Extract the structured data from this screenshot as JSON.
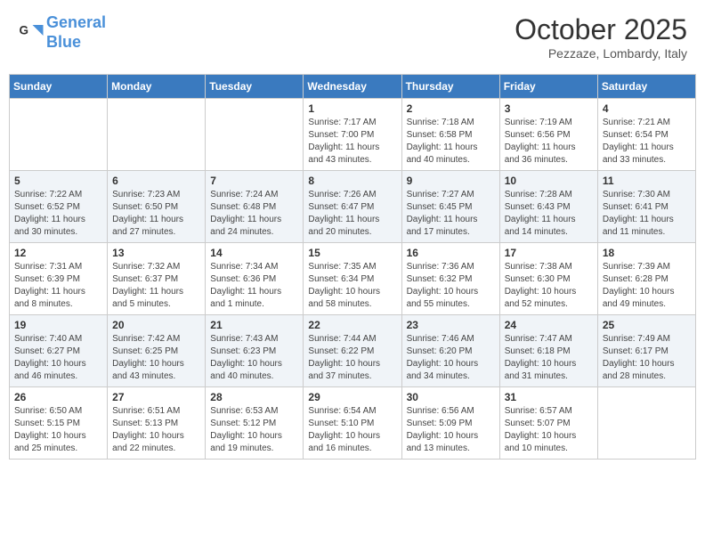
{
  "header": {
    "logo_line1": "General",
    "logo_line2": "Blue",
    "month": "October 2025",
    "location": "Pezzaze, Lombardy, Italy"
  },
  "weekdays": [
    "Sunday",
    "Monday",
    "Tuesday",
    "Wednesday",
    "Thursday",
    "Friday",
    "Saturday"
  ],
  "weeks": [
    [
      {
        "day": "",
        "info": ""
      },
      {
        "day": "",
        "info": ""
      },
      {
        "day": "",
        "info": ""
      },
      {
        "day": "1",
        "info": "Sunrise: 7:17 AM\nSunset: 7:00 PM\nDaylight: 11 hours\nand 43 minutes."
      },
      {
        "day": "2",
        "info": "Sunrise: 7:18 AM\nSunset: 6:58 PM\nDaylight: 11 hours\nand 40 minutes."
      },
      {
        "day": "3",
        "info": "Sunrise: 7:19 AM\nSunset: 6:56 PM\nDaylight: 11 hours\nand 36 minutes."
      },
      {
        "day": "4",
        "info": "Sunrise: 7:21 AM\nSunset: 6:54 PM\nDaylight: 11 hours\nand 33 minutes."
      }
    ],
    [
      {
        "day": "5",
        "info": "Sunrise: 7:22 AM\nSunset: 6:52 PM\nDaylight: 11 hours\nand 30 minutes."
      },
      {
        "day": "6",
        "info": "Sunrise: 7:23 AM\nSunset: 6:50 PM\nDaylight: 11 hours\nand 27 minutes."
      },
      {
        "day": "7",
        "info": "Sunrise: 7:24 AM\nSunset: 6:48 PM\nDaylight: 11 hours\nand 24 minutes."
      },
      {
        "day": "8",
        "info": "Sunrise: 7:26 AM\nSunset: 6:47 PM\nDaylight: 11 hours\nand 20 minutes."
      },
      {
        "day": "9",
        "info": "Sunrise: 7:27 AM\nSunset: 6:45 PM\nDaylight: 11 hours\nand 17 minutes."
      },
      {
        "day": "10",
        "info": "Sunrise: 7:28 AM\nSunset: 6:43 PM\nDaylight: 11 hours\nand 14 minutes."
      },
      {
        "day": "11",
        "info": "Sunrise: 7:30 AM\nSunset: 6:41 PM\nDaylight: 11 hours\nand 11 minutes."
      }
    ],
    [
      {
        "day": "12",
        "info": "Sunrise: 7:31 AM\nSunset: 6:39 PM\nDaylight: 11 hours\nand 8 minutes."
      },
      {
        "day": "13",
        "info": "Sunrise: 7:32 AM\nSunset: 6:37 PM\nDaylight: 11 hours\nand 5 minutes."
      },
      {
        "day": "14",
        "info": "Sunrise: 7:34 AM\nSunset: 6:36 PM\nDaylight: 11 hours\nand 1 minute."
      },
      {
        "day": "15",
        "info": "Sunrise: 7:35 AM\nSunset: 6:34 PM\nDaylight: 10 hours\nand 58 minutes."
      },
      {
        "day": "16",
        "info": "Sunrise: 7:36 AM\nSunset: 6:32 PM\nDaylight: 10 hours\nand 55 minutes."
      },
      {
        "day": "17",
        "info": "Sunrise: 7:38 AM\nSunset: 6:30 PM\nDaylight: 10 hours\nand 52 minutes."
      },
      {
        "day": "18",
        "info": "Sunrise: 7:39 AM\nSunset: 6:28 PM\nDaylight: 10 hours\nand 49 minutes."
      }
    ],
    [
      {
        "day": "19",
        "info": "Sunrise: 7:40 AM\nSunset: 6:27 PM\nDaylight: 10 hours\nand 46 minutes."
      },
      {
        "day": "20",
        "info": "Sunrise: 7:42 AM\nSunset: 6:25 PM\nDaylight: 10 hours\nand 43 minutes."
      },
      {
        "day": "21",
        "info": "Sunrise: 7:43 AM\nSunset: 6:23 PM\nDaylight: 10 hours\nand 40 minutes."
      },
      {
        "day": "22",
        "info": "Sunrise: 7:44 AM\nSunset: 6:22 PM\nDaylight: 10 hours\nand 37 minutes."
      },
      {
        "day": "23",
        "info": "Sunrise: 7:46 AM\nSunset: 6:20 PM\nDaylight: 10 hours\nand 34 minutes."
      },
      {
        "day": "24",
        "info": "Sunrise: 7:47 AM\nSunset: 6:18 PM\nDaylight: 10 hours\nand 31 minutes."
      },
      {
        "day": "25",
        "info": "Sunrise: 7:49 AM\nSunset: 6:17 PM\nDaylight: 10 hours\nand 28 minutes."
      }
    ],
    [
      {
        "day": "26",
        "info": "Sunrise: 6:50 AM\nSunset: 5:15 PM\nDaylight: 10 hours\nand 25 minutes."
      },
      {
        "day": "27",
        "info": "Sunrise: 6:51 AM\nSunset: 5:13 PM\nDaylight: 10 hours\nand 22 minutes."
      },
      {
        "day": "28",
        "info": "Sunrise: 6:53 AM\nSunset: 5:12 PM\nDaylight: 10 hours\nand 19 minutes."
      },
      {
        "day": "29",
        "info": "Sunrise: 6:54 AM\nSunset: 5:10 PM\nDaylight: 10 hours\nand 16 minutes."
      },
      {
        "day": "30",
        "info": "Sunrise: 6:56 AM\nSunset: 5:09 PM\nDaylight: 10 hours\nand 13 minutes."
      },
      {
        "day": "31",
        "info": "Sunrise: 6:57 AM\nSunset: 5:07 PM\nDaylight: 10 hours\nand 10 minutes."
      },
      {
        "day": "",
        "info": ""
      }
    ]
  ]
}
